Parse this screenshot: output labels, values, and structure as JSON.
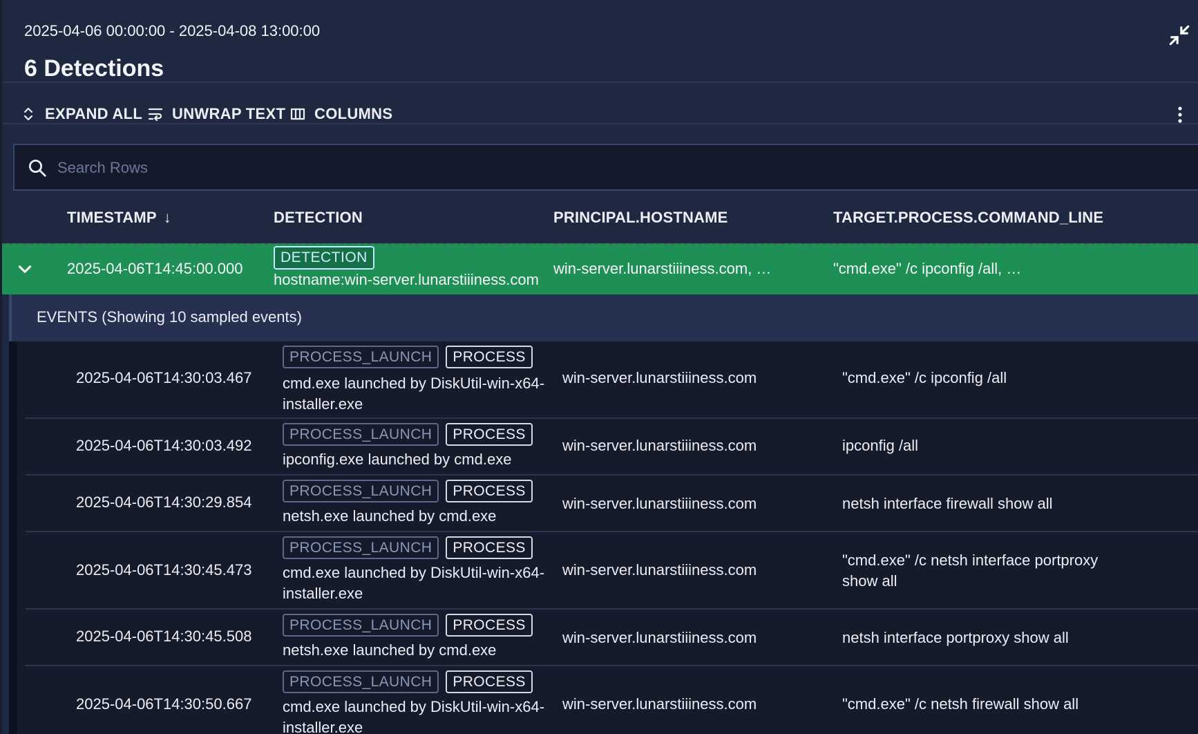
{
  "header": {
    "date_range": "2025-04-06 00:00:00 - 2025-04-08 13:00:00",
    "title": "6 Detections"
  },
  "toolbar": {
    "expand_all": "EXPAND ALL",
    "unwrap_text": "UNWRAP TEXT",
    "columns": "COLUMNS"
  },
  "search": {
    "placeholder": "Search Rows"
  },
  "columns": [
    "TIMESTAMP",
    "DETECTION",
    "PRINCIPAL.HOSTNAME",
    "TARGET.PROCESS.COMMAND_LINE"
  ],
  "sort_indicator": "↓",
  "detection": {
    "timestamp": "2025-04-06T14:45:00.000",
    "tag": "DETECTION",
    "detail": "hostname:win-server.lunarstiiiness.com",
    "hostname": "win-server.lunarstiiiness.com, …",
    "command_line": "\"cmd.exe\" /c ipconfig /all, …"
  },
  "events_label": "EVENTS (Showing 10 sampled events)",
  "event_tags": {
    "type": "PROCESS_LAUNCH",
    "category": "PROCESS"
  },
  "events": [
    {
      "timestamp": "2025-04-06T14:30:03.467",
      "description": "cmd.exe launched by DiskUtil-win-x64-installer.exe",
      "hostname": "win-server.lunarstiiiness.com",
      "command_line": "\"cmd.exe\" /c ipconfig /all"
    },
    {
      "timestamp": "2025-04-06T14:30:03.492",
      "description": "ipconfig.exe launched by cmd.exe",
      "hostname": "win-server.lunarstiiiness.com",
      "command_line": "ipconfig /all"
    },
    {
      "timestamp": "2025-04-06T14:30:29.854",
      "description": "netsh.exe launched by cmd.exe",
      "hostname": "win-server.lunarstiiiness.com",
      "command_line": "netsh interface firewall show all"
    },
    {
      "timestamp": "2025-04-06T14:30:45.473",
      "description": "cmd.exe launched by DiskUtil-win-x64-installer.exe",
      "hostname": "win-server.lunarstiiiness.com",
      "command_line": "\"cmd.exe\" /c netsh interface portproxy show all"
    },
    {
      "timestamp": "2025-04-06T14:30:45.508",
      "description": "netsh.exe launched by cmd.exe",
      "hostname": "win-server.lunarstiiiness.com",
      "command_line": "netsh interface portproxy show all"
    },
    {
      "timestamp": "2025-04-06T14:30:50.667",
      "description": "cmd.exe launched by DiskUtil-win-x64-installer.exe",
      "hostname": "win-server.lunarstiiiness.com",
      "command_line": "\"cmd.exe\" /c netsh firewall show all"
    }
  ]
}
